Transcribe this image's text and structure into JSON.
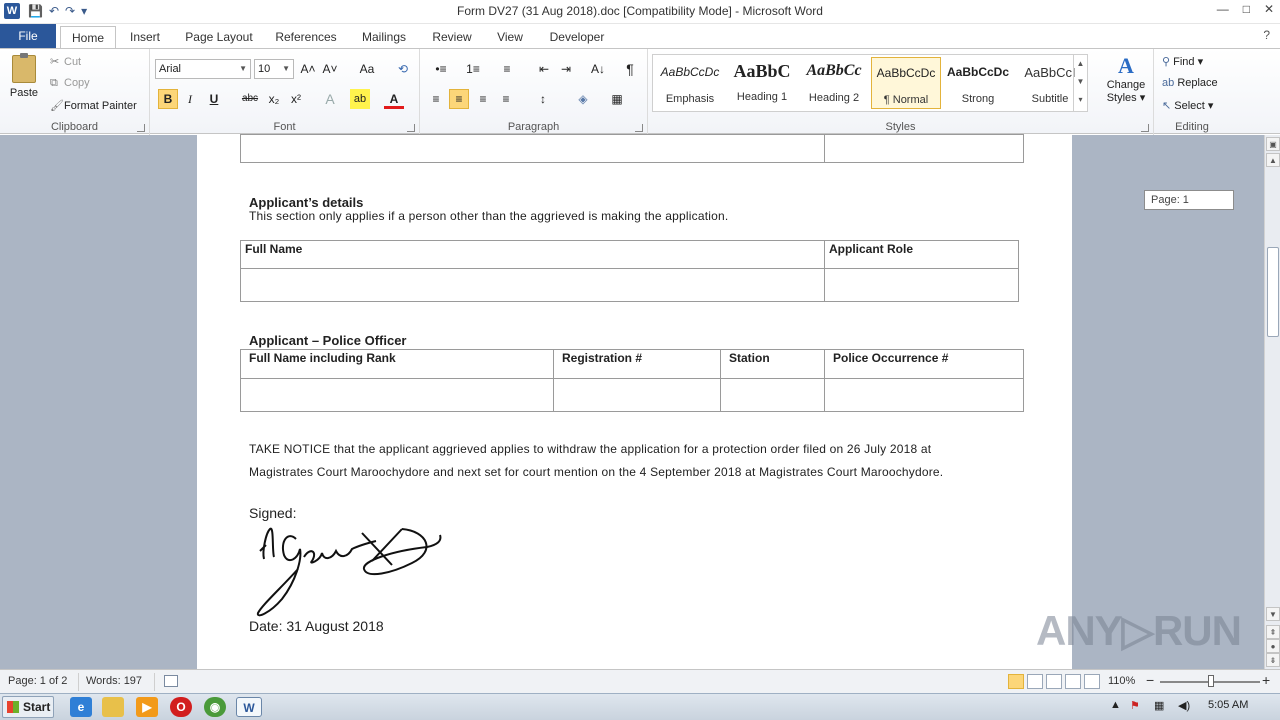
{
  "window": {
    "title": "Form DV27 (31 Aug 2018).doc [Compatibility Mode]  -  Microsoft Word",
    "app_icon": "W",
    "minimize": "—",
    "maximize": "□",
    "close": "✕"
  },
  "qat": {
    "save": "💾",
    "undo": "↶",
    "redo": "↷",
    "customize": "▾"
  },
  "tabs": [
    {
      "label": "File"
    },
    {
      "label": "Home"
    },
    {
      "label": "Insert"
    },
    {
      "label": "Page Layout"
    },
    {
      "label": "References"
    },
    {
      "label": "Mailings"
    },
    {
      "label": "Review"
    },
    {
      "label": "View"
    },
    {
      "label": "Developer"
    }
  ],
  "help_icon": "?",
  "ribbon": {
    "clipboard": {
      "label": "Clipboard",
      "paste": "Paste",
      "cut": "Cut",
      "copy": "Copy",
      "format_painter": "Format Painter"
    },
    "font": {
      "label": "Font",
      "font_name": "Arial",
      "font_size": "10",
      "grow": "A˄",
      "shrink": "A˅",
      "change_case": "Aa",
      "clear": "⟲",
      "bold": "B",
      "italic": "I",
      "underline": "U",
      "strike": "abc",
      "subscript": "x₂",
      "superscript": "x²",
      "effects": "A",
      "highlight": "ab",
      "font_color": "A"
    },
    "paragraph": {
      "label": "Paragraph",
      "bullets": "•≡",
      "numbering": "1≡",
      "multilevel": "≡",
      "decrease_indent": "⇤",
      "increase_indent": "⇥",
      "sort": "A↓",
      "pilcrow": "¶",
      "align_left": "≡",
      "center": "≡",
      "align_right": "≡",
      "justify": "≡",
      "line_spacing": "↕",
      "shading": "◈",
      "borders": "▦"
    },
    "styles": {
      "label": "Styles",
      "items": [
        {
          "sample": "AaBbCcDc",
          "name": "Emphasis"
        },
        {
          "sample": "AaBbC",
          "name": "Heading 1"
        },
        {
          "sample": "AaBbCc",
          "name": "Heading 2"
        },
        {
          "sample": "AaBbCcDc",
          "name": "¶ Normal"
        },
        {
          "sample": "AaBbCcDc",
          "name": "Strong"
        },
        {
          "sample": "AaBbCcI",
          "name": "Subtitle"
        }
      ],
      "change_styles_line1": "Change",
      "change_styles_line2": "Styles ▾"
    },
    "editing": {
      "label": "Editing",
      "find": "Find ▾",
      "replace": "Replace",
      "select": "Select ▾"
    }
  },
  "document": {
    "page_badge": "Page: 1",
    "applicant": {
      "title": "Applicant’s details",
      "subtitle": "This section only applies if a person  other than the aggrieved  is making the application.",
      "col1": "Full Name",
      "col2": "Applicant Role"
    },
    "police": {
      "title": "Applicant – Police Officer",
      "col1": "Full Name including Rank",
      "col2": "Registration #",
      "col3": "Station",
      "col4": "Police Occurrence #"
    },
    "notice_line1": "TAKE NOTICE  that the applicant  aggrieved  applies to withdraw the application for a protection order filed on 26 July 2018 at",
    "notice_line2": "Magistrates Court Maroochydore  and next set for court mention on the 4 September 2018 at Magistrates Court Maroochydore.",
    "signed_label": "Signed:",
    "date_label": "Date:  31 August 2018"
  },
  "watermark": "ANY▷RUN",
  "statusbar": {
    "page": "Page: 1 of 2",
    "words": "Words: 197",
    "zoom": "110%",
    "zoom_out": "−",
    "zoom_in": "+"
  },
  "taskbar": {
    "start": "Start",
    "clock": "5:05 AM"
  }
}
